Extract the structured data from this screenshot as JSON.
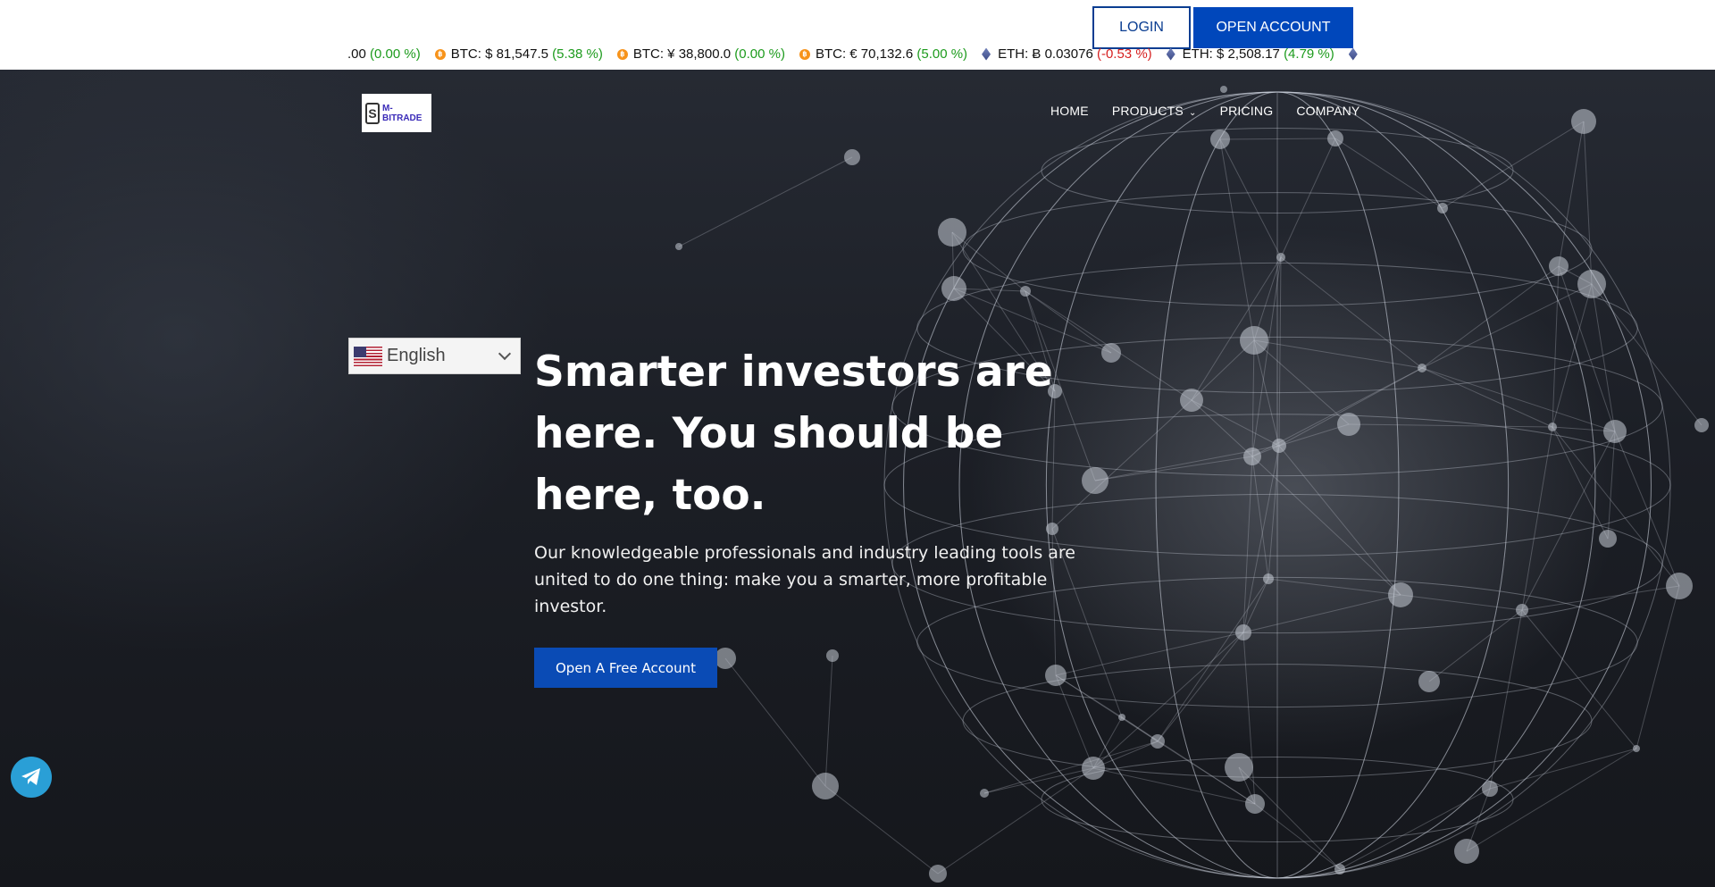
{
  "topbar": {
    "login_label": "LOGIN",
    "open_account_label": "OPEN ACCOUNT"
  },
  "ticker": {
    "lead": ".00",
    "lead_change": "(0.00 %)",
    "items": [
      {
        "icon": "bitcoin-icon",
        "text": "BTC: $ 81,547.5",
        "change": "(5.38 %)",
        "dir": "pos"
      },
      {
        "icon": "bitcoin-icon",
        "text": "BTC: ¥ 38,800.0",
        "change": "(0.00 %)",
        "dir": "pos"
      },
      {
        "icon": "bitcoin-icon",
        "text": "BTC: € 70,132.6",
        "change": "(5.00 %)",
        "dir": "pos"
      },
      {
        "icon": "ethereum-icon",
        "text": "ETH: Ƀ 0.03076",
        "change": "(-0.53 %)",
        "dir": "neg"
      },
      {
        "icon": "ethereum-icon",
        "text": "ETH: $ 2,508.17",
        "change": "(4.79 %)",
        "dir": "pos"
      }
    ],
    "trail": "I"
  },
  "logo": {
    "text_line1": "M-",
    "text_line2": "BITRADE"
  },
  "nav": {
    "home": "HOME",
    "products": "PRODUCTS",
    "pricing": "PRICING",
    "company": "COMPANY"
  },
  "language": {
    "selected": "English"
  },
  "hero": {
    "headline": "Smarter investors are here. You should be here, too.",
    "subtext": "Our knowledgeable professionals and industry leading tools are united to do one thing: make you a smarter, more profitable investor.",
    "cta_label": "Open A Free Account"
  },
  "colors": {
    "primary": "#0047bb",
    "positive": "#1d9b1d",
    "negative": "#d62020",
    "telegram": "#2a9fd6"
  }
}
